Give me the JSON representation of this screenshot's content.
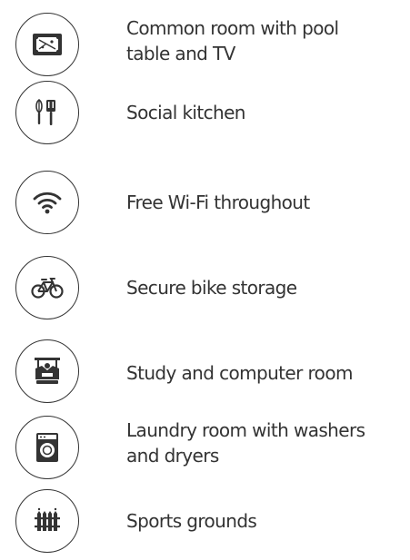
{
  "theme": {
    "ink": "#333333",
    "background": "#ffffff"
  },
  "amenities": [
    {
      "label": "Common room with pool\ntable and TV",
      "icon": "pool-table-icon"
    },
    {
      "label": "Social kitchen",
      "icon": "kitchen-utensils-icon"
    },
    {
      "label": "Free Wi-Fi throughout",
      "icon": "wifi-icon"
    },
    {
      "label": "Secure bike storage",
      "icon": "bicycle-icon"
    },
    {
      "label": "Study and computer room",
      "icon": "study-desk-icon"
    },
    {
      "label": "Laundry room with washers\nand dryers",
      "icon": "washing-machine-icon"
    },
    {
      "label": "Sports grounds",
      "icon": "fence-icon"
    }
  ]
}
